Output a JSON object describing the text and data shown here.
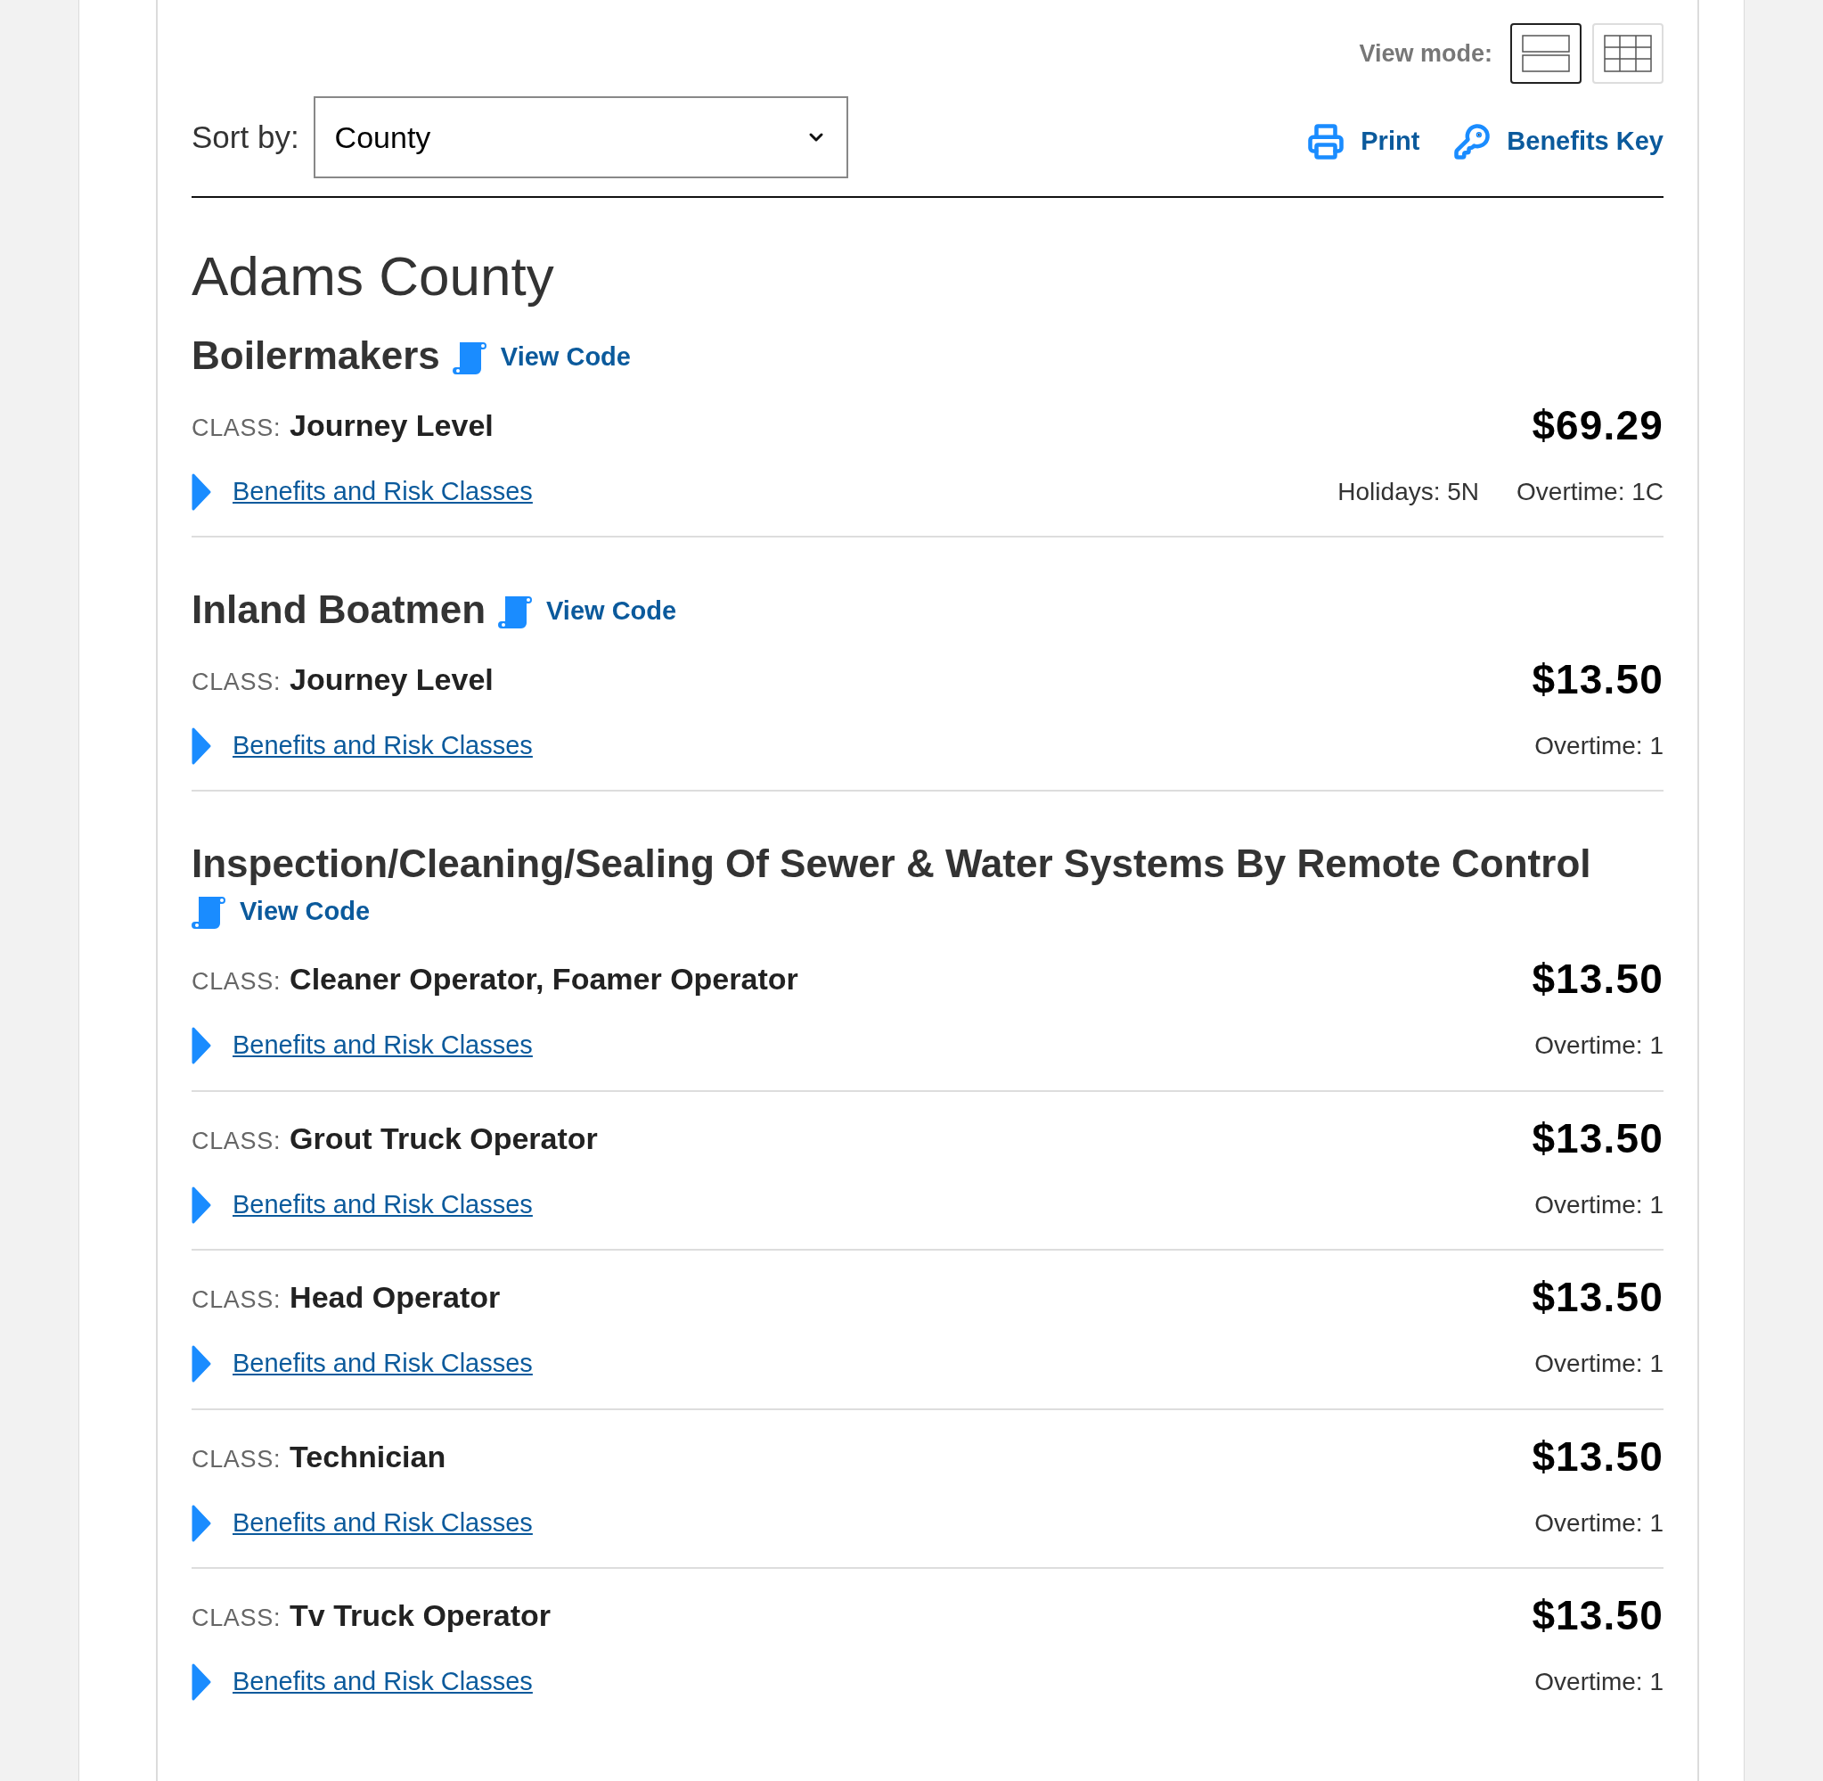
{
  "view_mode": {
    "label": "View mode:",
    "options": [
      {
        "kind": "list",
        "selected": true
      },
      {
        "kind": "grid",
        "selected": false
      }
    ]
  },
  "sort": {
    "label": "Sort by:",
    "value": "County"
  },
  "actions": [
    {
      "kind": "print",
      "label": "Print"
    },
    {
      "kind": "key",
      "label": "Benefits Key"
    }
  ],
  "county": "Adams County",
  "trades": [
    {
      "name": "Boilermakers",
      "view_code": "View Code",
      "classes": [
        {
          "class_label": "CLASS:",
          "name": "Journey Level",
          "rate": "$69.29",
          "link": "Benefits and Risk Classes",
          "expanded": false,
          "notes": [
            "Holidays: 5N",
            "Overtime: 1C"
          ]
        }
      ]
    },
    {
      "name": "Inland Boatmen",
      "view_code": "View Code",
      "classes": [
        {
          "class_label": "CLASS:",
          "name": "Journey Level",
          "rate": "$13.50",
          "link": "Benefits and Risk Classes",
          "expanded": false,
          "notes": [
            "Overtime: 1"
          ]
        }
      ]
    },
    {
      "name": "Inspection/Cleaning/Sealing Of Sewer & Water Systems By Remote Control",
      "view_code": "View Code",
      "classes": [
        {
          "class_label": "CLASS:",
          "name": "Cleaner Operator, Foamer Operator",
          "rate": "$13.50",
          "link": "Benefits and Risk Classes",
          "expanded": false,
          "notes": [
            "Overtime: 1"
          ]
        },
        {
          "class_label": "CLASS:",
          "name": "Grout Truck Operator",
          "rate": "$13.50",
          "link": "Benefits and Risk Classes",
          "expanded": false,
          "notes": [
            "Overtime: 1"
          ]
        },
        {
          "class_label": "CLASS:",
          "name": "Head Operator",
          "rate": "$13.50",
          "link": "Benefits and Risk Classes",
          "expanded": false,
          "notes": [
            "Overtime: 1"
          ]
        },
        {
          "class_label": "CLASS:",
          "name": "Technician",
          "rate": "$13.50",
          "link": "Benefits and Risk Classes",
          "expanded": false,
          "notes": [
            "Overtime: 1"
          ]
        },
        {
          "class_label": "CLASS:",
          "name": "Tv Truck Operator",
          "rate": "$13.50",
          "link": "Benefits and Risk Classes",
          "expanded": false,
          "notes": [
            "Overtime: 1"
          ]
        }
      ]
    }
  ]
}
